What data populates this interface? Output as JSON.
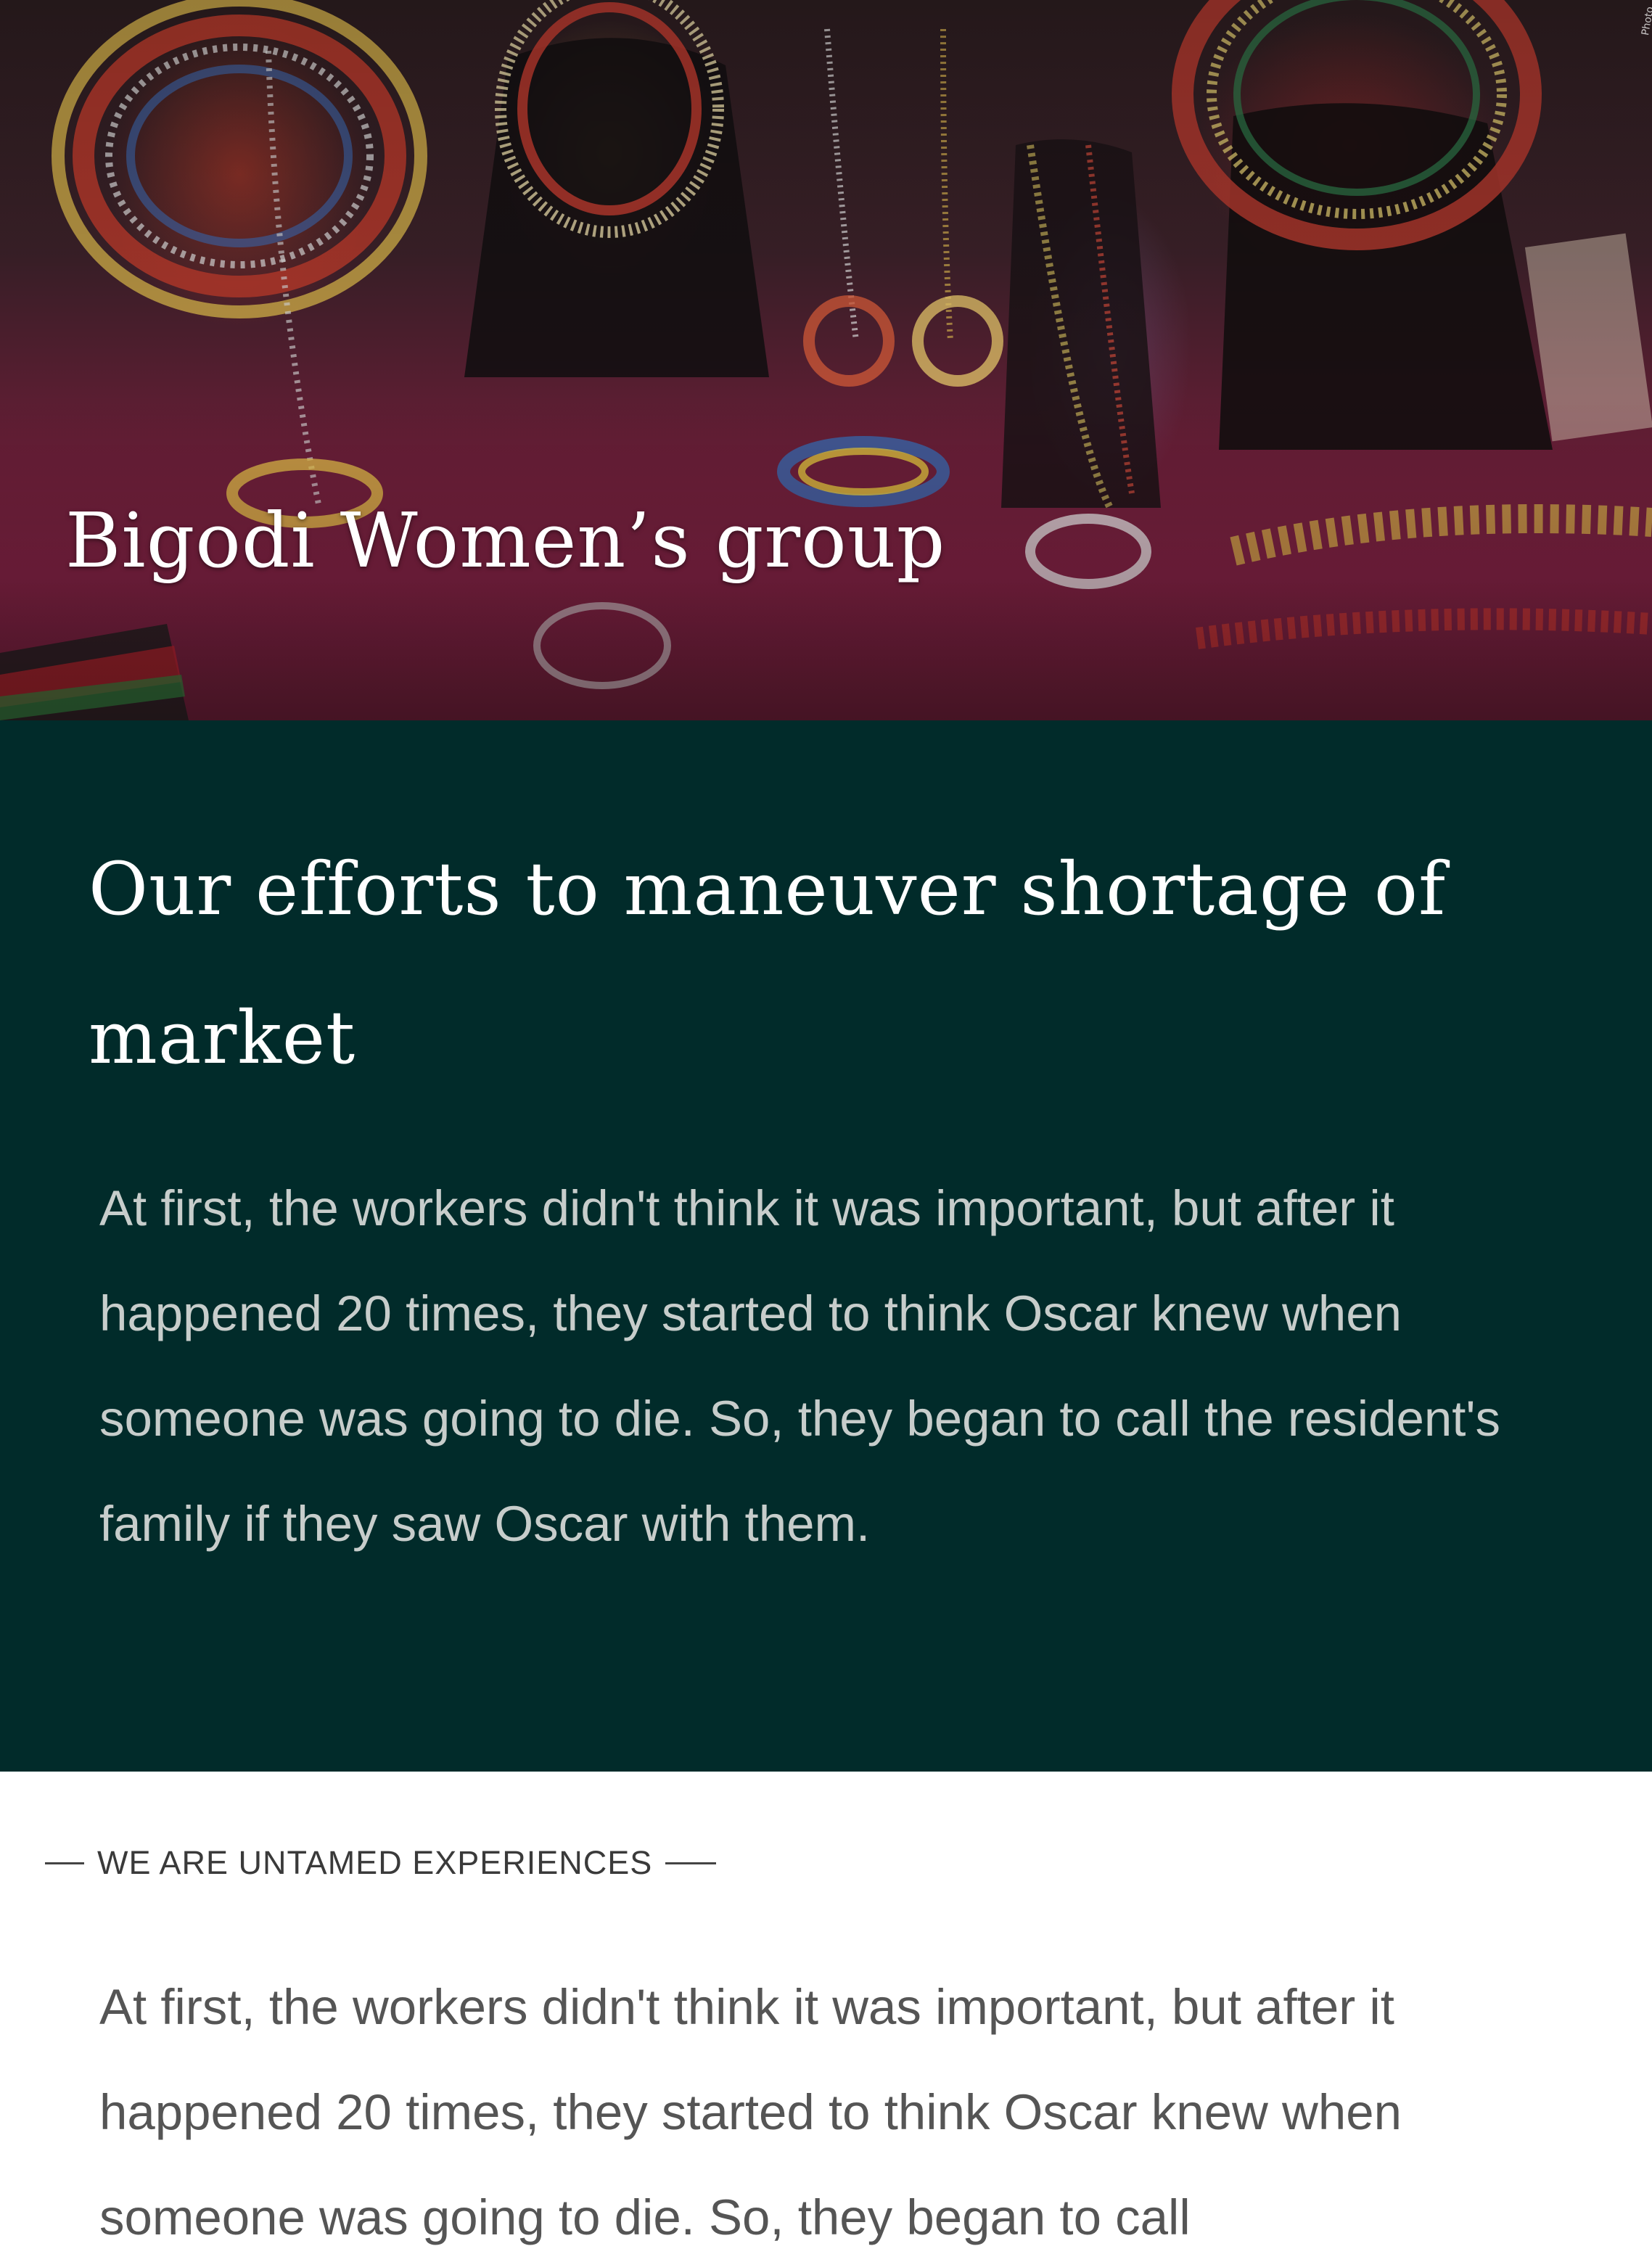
{
  "hero": {
    "title": "Bigodi Women’s group",
    "photo_credit": "Photo",
    "image_description_icon": "beaded-jewelry-photo"
  },
  "dark_section": {
    "title": "Our efforts to maneuver shortage of market",
    "body": "At first, the workers didn't think it was important, but after it happened 20 times, they started to think Oscar knew when someone was going to die. So, they began to call the resident's family if they saw Oscar with them.",
    "background_color": "#012b2a"
  },
  "white_section": {
    "eyebrow": "WE ARE UNTAMED EXPERIENCES",
    "body": "At first, the workers didn't think it was important, but after it happened 20 times, they started to think Oscar knew when someone was going to die. So, they began to call"
  }
}
